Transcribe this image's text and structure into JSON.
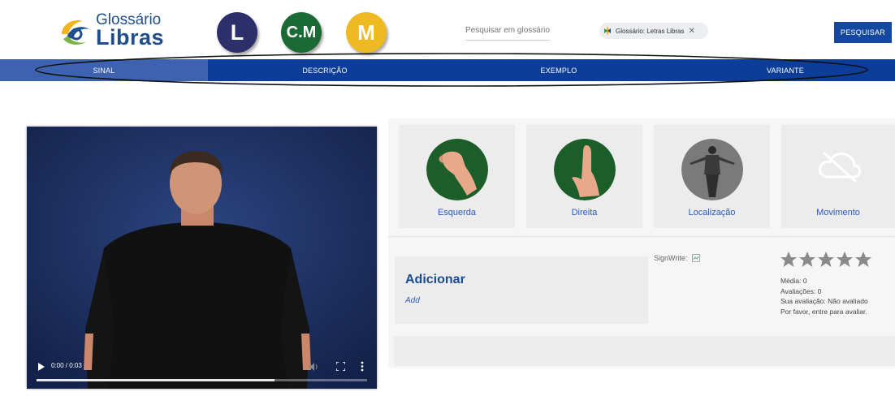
{
  "header": {
    "logo_line1": "Glossário",
    "logo_line2": "Libras",
    "glossary_buttons": [
      {
        "label": "L",
        "color": "#2d2f6b"
      },
      {
        "label": "C.M",
        "color": "#1b6a35"
      },
      {
        "label": "M",
        "color": "#efb921"
      }
    ],
    "search_placeholder": "Pesquisar em glossário",
    "filter_chip": "Glossário: Letras Libras",
    "search_button": "PESQUISAR"
  },
  "nav": {
    "tabs": [
      {
        "label": "SINAL",
        "active": true
      },
      {
        "label": "DESCRIÇÃO",
        "active": false
      },
      {
        "label": "EXEMPLO",
        "active": false
      },
      {
        "label": "VARIANTE",
        "active": false
      }
    ]
  },
  "video": {
    "time": "0:00 / 0:03",
    "progress": 0.72,
    "icons": [
      "play-icon",
      "volume-icon",
      "fullscreen-icon",
      "more-options-icon"
    ]
  },
  "parameters": [
    {
      "label": "Esquerda"
    },
    {
      "label": "Direita"
    },
    {
      "label": "Localização"
    },
    {
      "label": "Movimento"
    }
  ],
  "add_section": {
    "title": "Adicionar",
    "link": "Add"
  },
  "signwrite_label": "SignWrite:",
  "rating": {
    "stars_filled": 0,
    "stars_total": 5,
    "media": "Média: 0",
    "avaliacoes": "Avaliações: 0",
    "sua_avaliacao": "Sua avaliação: Não avaliado",
    "login_hint": "Por favor, entre para avaliar."
  },
  "colors": {
    "brand_blue": "#0b3d99",
    "active_tab": "#3c62b0",
    "link_blue": "#2a5bb8"
  }
}
